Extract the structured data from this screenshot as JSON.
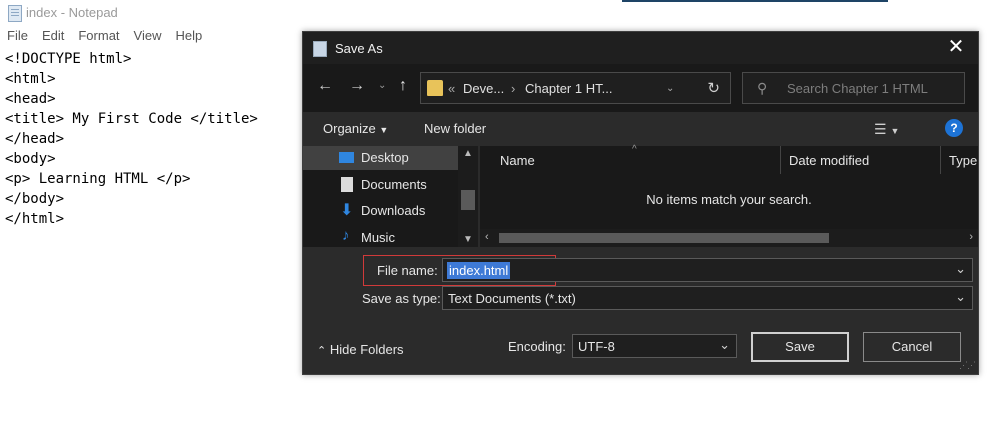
{
  "notepad": {
    "title": "index - Notepad",
    "menu": [
      "File",
      "Edit",
      "Format",
      "View",
      "Help"
    ],
    "lines": [
      "<!DOCTYPE html>",
      "<html>",
      "<head>",
      "<title> My First Code </title>",
      "</head>",
      "<body>",
      "<p> Learning HTML </p>",
      "</body>",
      "</html>"
    ]
  },
  "dialog": {
    "title": "Save As",
    "address": {
      "prefix": "«",
      "seg1": "Deve...",
      "seg2": "Chapter 1 HT..."
    },
    "search_placeholder": "Search Chapter 1 HTML",
    "toolbar": {
      "organize": "Organize",
      "new_folder": "New folder"
    },
    "nav_items": [
      "Desktop",
      "Documents",
      "Downloads",
      "Music"
    ],
    "columns": [
      "Name",
      "Date modified",
      "Type"
    ],
    "empty_message": "No items match your search.",
    "file_name_label": "File name:",
    "file_name_value": "index.html",
    "save_type_label": "Save as type:",
    "save_type_value": "Text Documents (*.txt)",
    "hide_folders": "Hide Folders",
    "encoding_label": "Encoding:",
    "encoding_value": "UTF-8",
    "save_button": "Save",
    "cancel_button": "Cancel"
  },
  "colors": {
    "dialog_bg": "#2b2b2b",
    "pane_bg": "#191919",
    "selection": "#3e7ad6",
    "highlight_box": "#d13a3a",
    "help_blue": "#1d73d6",
    "folder": "#e8c35a"
  },
  "icons": {
    "back": "arrow-left-icon",
    "forward": "arrow-right-icon",
    "up": "arrow-up-icon",
    "refresh": "refresh-icon",
    "search": "search-icon",
    "close": "close-icon",
    "help": "help-icon"
  }
}
